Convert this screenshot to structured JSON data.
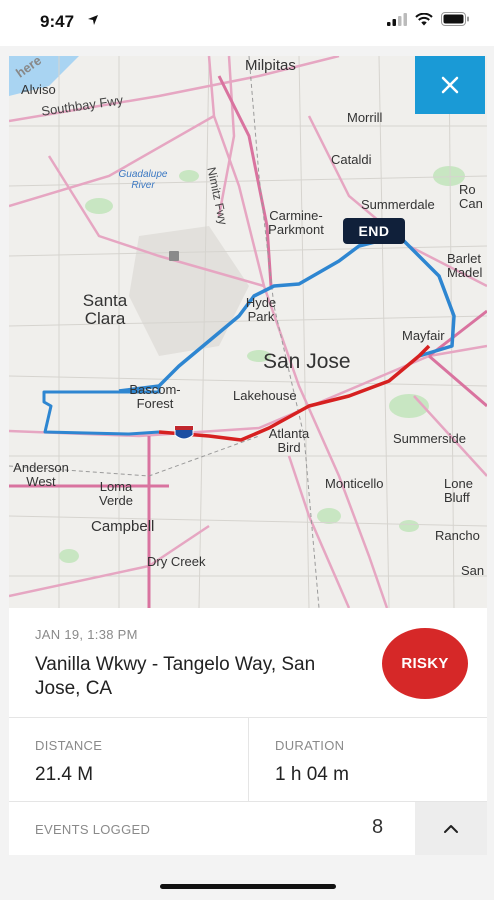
{
  "status_bar": {
    "time": "9:47"
  },
  "map": {
    "watermark": "here",
    "end_label": "END",
    "labels": {
      "milpitas": "Milpitas",
      "alviso": "Alviso",
      "southbay_fwy": "Southbay Fwy",
      "morrill": "Morrill",
      "cataldi": "Cataldi",
      "nimitz_fwy": "Nimitz Fwy",
      "guadalupe_river": "Guadalupe River",
      "summerdale": "Summerdale",
      "ro_can": "Ro Can",
      "carmine_parkmont": "Carmine-Parkmont",
      "barlett_madel": "Barlet Madel",
      "santa_clara": "Santa Clara",
      "hyde_park": "Hyde Park",
      "mayfair": "Mayfair",
      "san_jose": "San Jose",
      "bascom_forest": "Bascom-Forest",
      "lakehouse": "Lakehouse",
      "atlanta_bird": "Atlanta Bird",
      "summerside": "Summerside",
      "anderson_west": "Anderson West",
      "loma_verde": "Loma Verde",
      "monticello": "Monticello",
      "lone_bluff": "Lone Bluff",
      "campbell": "Campbell",
      "rancho": "Rancho",
      "dry_creek": "Dry Creek",
      "san": "San"
    },
    "route_colors": {
      "normal": "#2e86d1",
      "risky": "#d62020"
    }
  },
  "trip": {
    "date": "JAN 19, 1:38 PM",
    "address": "Vanilla Wkwy - Tangelo Way, San Jose, CA",
    "rating": "RISKY"
  },
  "stats": {
    "distance_label": "DISTANCE",
    "distance_value": "21.4 M",
    "duration_label": "DURATION",
    "duration_value": "1 h 04 m"
  },
  "events": {
    "label": "EVENTS LOGGED",
    "count": "8"
  }
}
